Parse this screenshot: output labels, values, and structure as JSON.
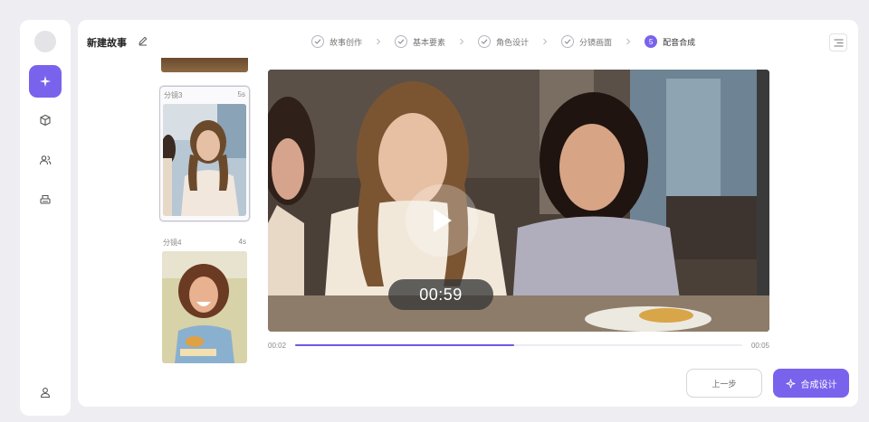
{
  "header": {
    "title": "新建故事"
  },
  "steps": [
    {
      "label": "故事创作"
    },
    {
      "label": "基本要素"
    },
    {
      "label": "角色设计"
    },
    {
      "label": "分镜画面"
    },
    {
      "label": "配音合成",
      "number": "5"
    }
  ],
  "storyboards": [
    {
      "label": "分镜3",
      "duration": "5s"
    },
    {
      "label": "分镜4",
      "duration": "4s"
    }
  ],
  "player": {
    "time_display": "00:59",
    "current_time": "00:02",
    "total_time": "00:05",
    "progress": 0.49
  },
  "footer": {
    "prev_label": "上一步",
    "next_label": "合成设计"
  },
  "colors": {
    "accent": "#7a63ec",
    "progress": "#6f57e6"
  },
  "icons": {
    "sidebar": [
      "sparkle-icon",
      "cube-icon",
      "users-icon",
      "printer-icon",
      "user-icon"
    ],
    "header": [
      "pencil-icon",
      "menu-icon"
    ],
    "player": "play-icon"
  }
}
